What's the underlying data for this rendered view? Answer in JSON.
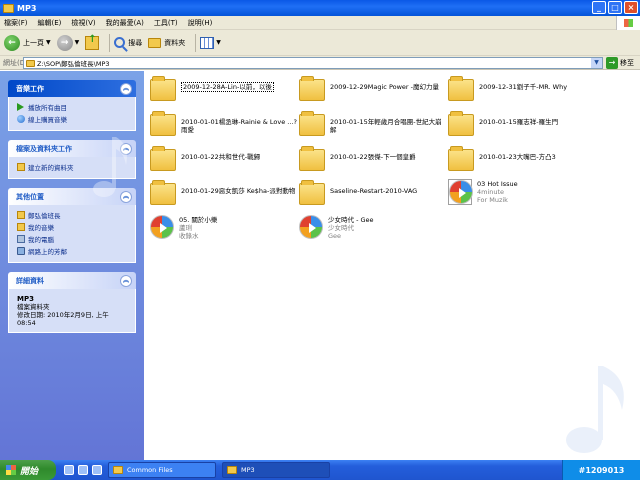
{
  "window": {
    "title": "MP3"
  },
  "menu": [
    "檔案(F)",
    "編輯(E)",
    "檢視(V)",
    "我的最愛(A)",
    "工具(T)",
    "說明(H)"
  ],
  "toolbar": {
    "back": "上一頁",
    "search": "搜尋",
    "folders": "資料夾"
  },
  "address": {
    "label": "網址(D)",
    "path": "Z:\\SOP\\鄭弘倫班長\\MP3",
    "go": "移至"
  },
  "taskpane": {
    "music": {
      "title": "音樂工作",
      "items": [
        "播放所有曲目",
        "線上購買音樂"
      ]
    },
    "file": {
      "title": "檔案及資料夾工作",
      "items": [
        "建立新的資料夾"
      ]
    },
    "places": {
      "title": "其他位置",
      "items": [
        "鄭弘倫班長",
        "我的音樂",
        "我的電腦",
        "網路上的芳鄰"
      ]
    },
    "details": {
      "title": "詳細資料",
      "name": "MP3",
      "type": "檔案資料夾",
      "modified": "修改日期: 2010年2月9日, 上午 08:54"
    }
  },
  "files": [
    {
      "kind": "folder",
      "name": "2009-12-28A-Lin-以前，以後"
    },
    {
      "kind": "folder",
      "name": "2009-12-29Magic Power -魔幻力量"
    },
    {
      "kind": "folder",
      "name": "2009-12-31劉子千-MR. Why"
    },
    {
      "kind": "folder",
      "name": "2010-01-01楊丞琳-Rainie & Love ...? 雨愛"
    },
    {
      "kind": "folder",
      "name": "2010-01-15年輕歲月合唱團-世紀大崩解"
    },
    {
      "kind": "folder",
      "name": "2010-01-15羅志祥-羅生門"
    },
    {
      "kind": "folder",
      "name": "2010-01-22共和世代-戰歸"
    },
    {
      "kind": "folder",
      "name": "2010-01-22張傑-下一個皇爵"
    },
    {
      "kind": "folder",
      "name": "2010-01-23大嘴巴-方凸3"
    },
    {
      "kind": "folder",
      "name": "2010-01-29惡女凱莎 Ke$ha-派對動物"
    },
    {
      "kind": "folder",
      "name": "Saseline-Restart-2010-VAG"
    },
    {
      "kind": "media-card",
      "name": "03 Hot Issue",
      "sub1": "4minute",
      "sub2": "For Muzik"
    },
    {
      "kind": "media",
      "name": "05. 關於小樂",
      "sub1": "蘆琍",
      "sub2": "收錄水"
    },
    {
      "kind": "media",
      "name": "少女時代 - Gee",
      "sub1": "少女時代",
      "sub2": "Gee"
    }
  ],
  "taskbar": {
    "start": "開始",
    "tasks": [
      "Common Files",
      "MP3"
    ],
    "tray": "#1209013"
  }
}
